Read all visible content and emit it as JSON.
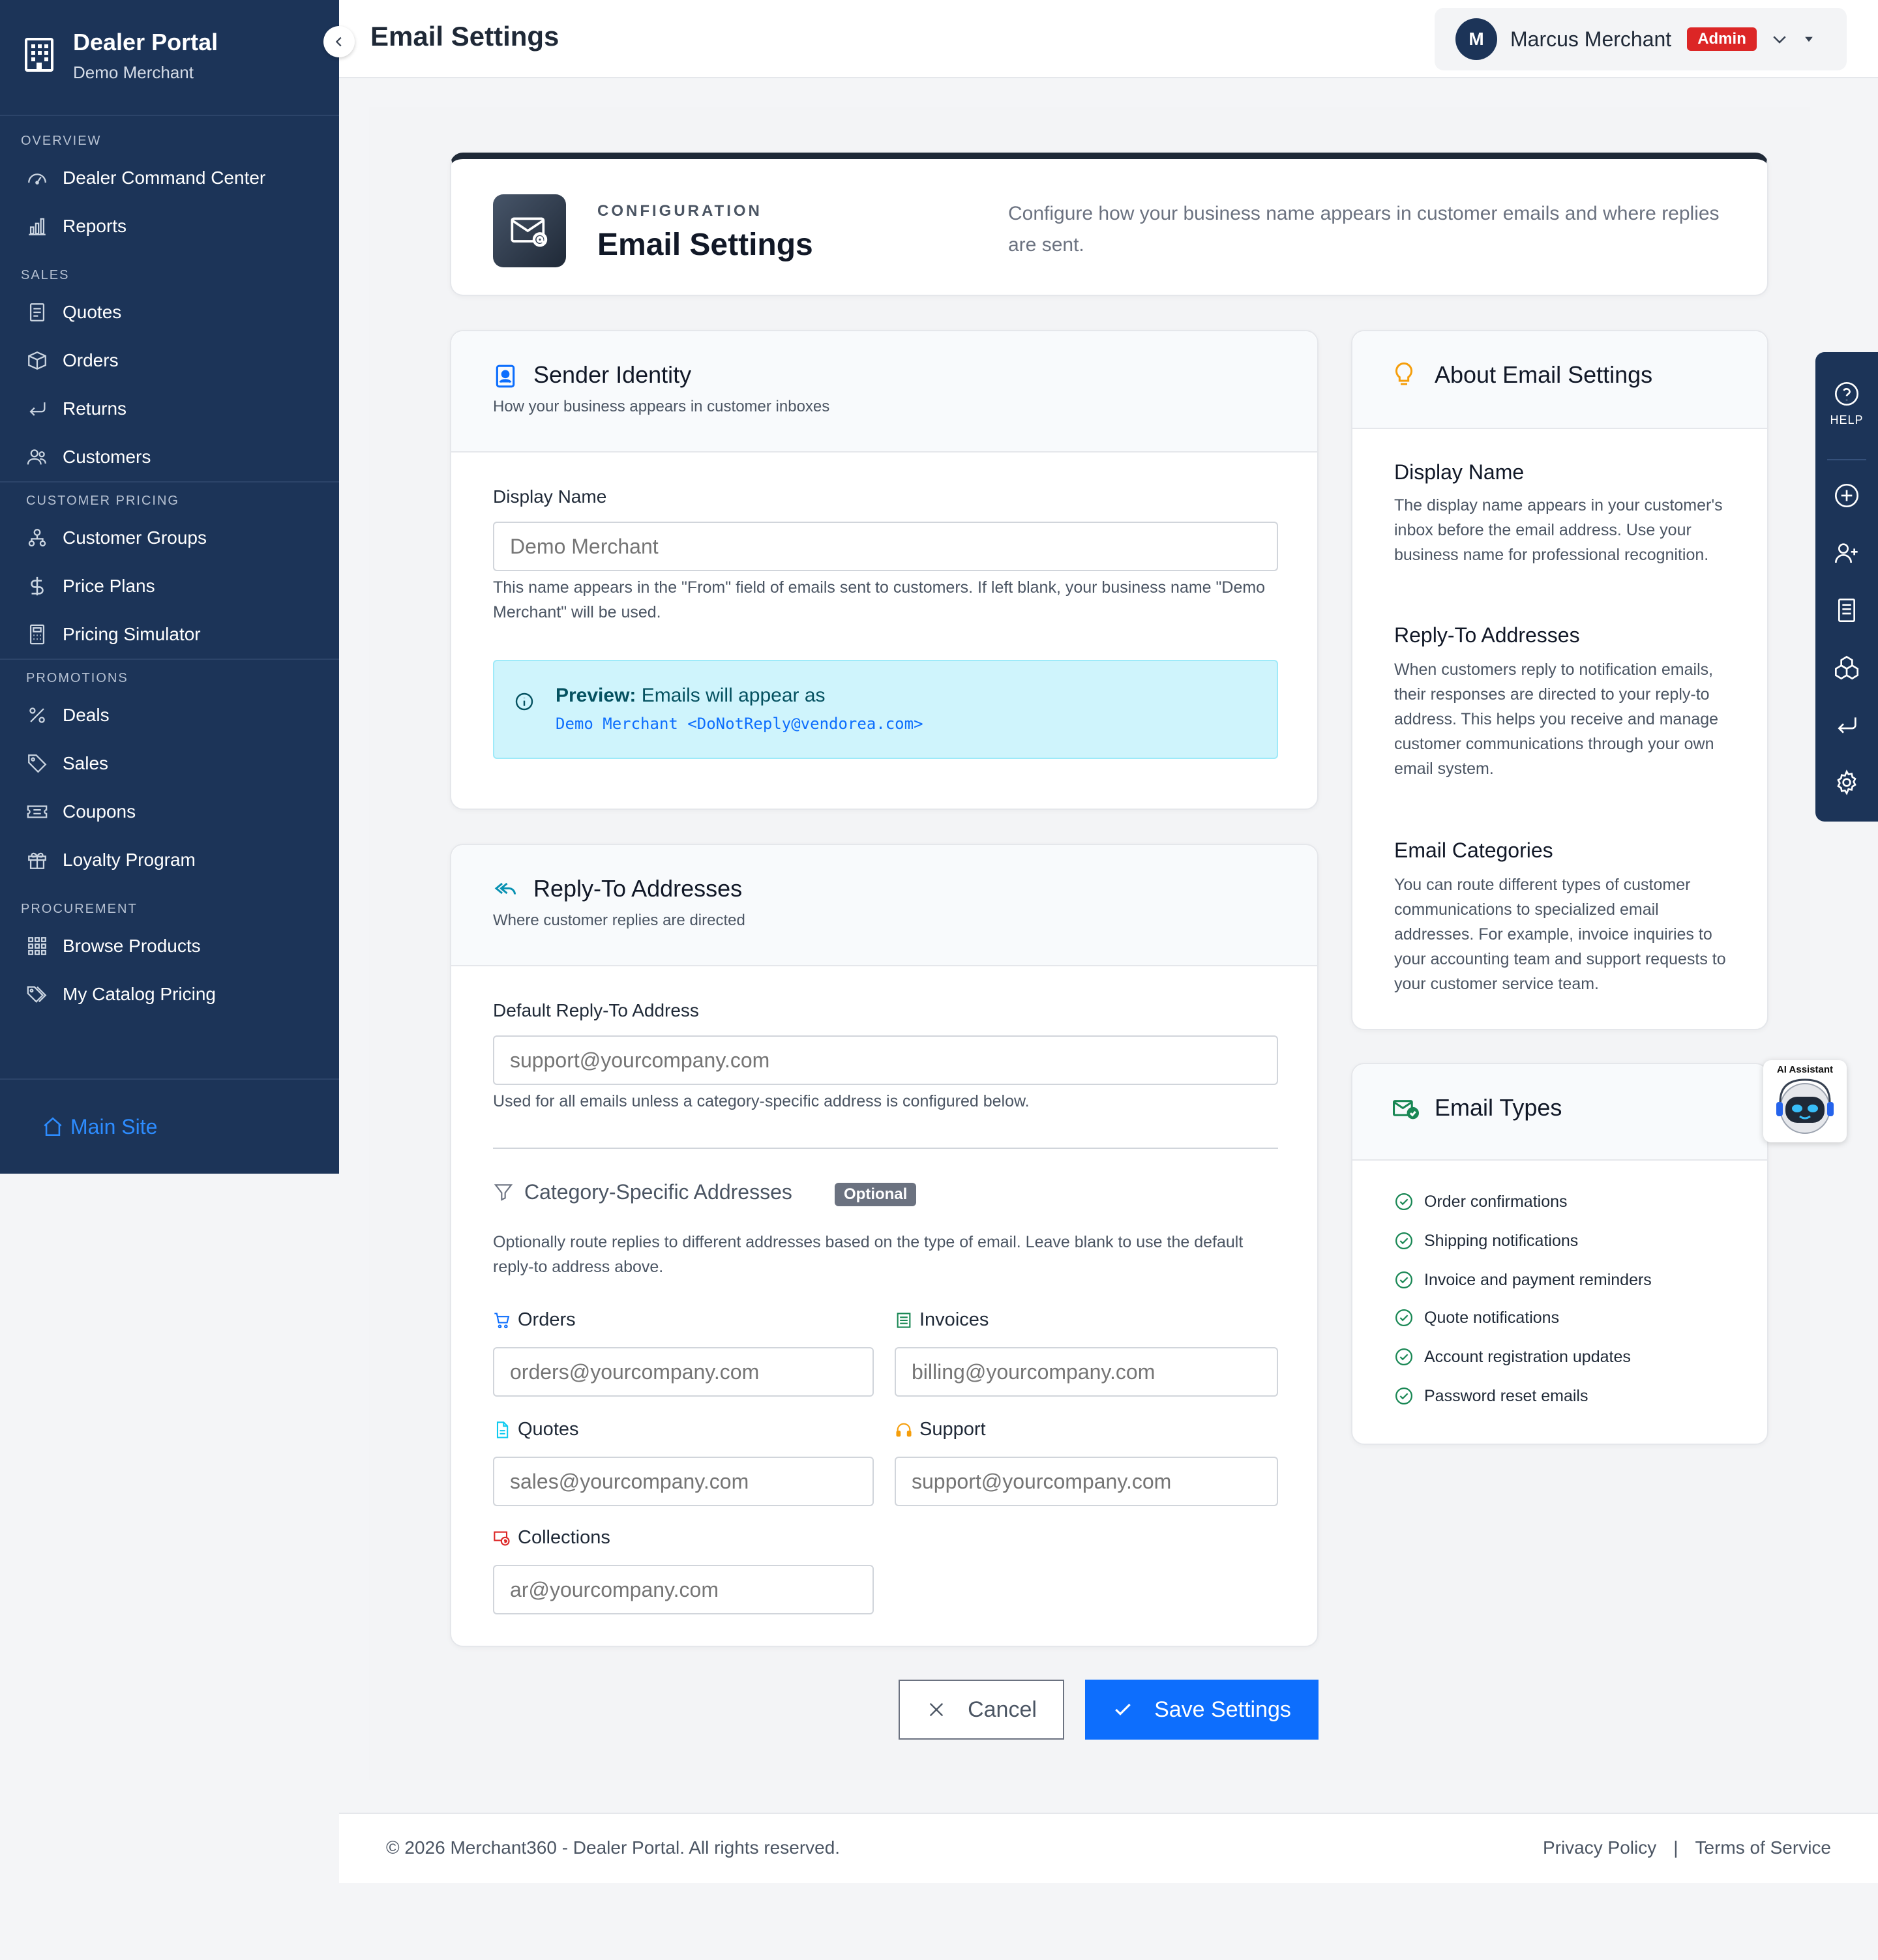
{
  "sidebar": {
    "title": "Dealer Portal",
    "subtitle": "Demo Merchant",
    "sections": [
      {
        "label": "OVERVIEW",
        "items": [
          {
            "label": "Dealer Command Center",
            "icon": "gauge-icon"
          },
          {
            "label": "Reports",
            "icon": "bar-chart-icon"
          }
        ]
      },
      {
        "label": "SALES",
        "items": [
          {
            "label": "Quotes",
            "icon": "document-icon"
          },
          {
            "label": "Orders",
            "icon": "box-icon"
          },
          {
            "label": "Returns",
            "icon": "return-arrow-icon"
          },
          {
            "label": "Customers",
            "icon": "people-icon"
          }
        ]
      },
      {
        "label": "CUSTOMER PRICING",
        "items": [
          {
            "label": "Customer Groups",
            "icon": "hierarchy-icon"
          },
          {
            "label": "Price Plans",
            "icon": "dollar-icon"
          },
          {
            "label": "Pricing Simulator",
            "icon": "calculator-icon"
          }
        ]
      },
      {
        "label": "PROMOTIONS",
        "items": [
          {
            "label": "Deals",
            "icon": "percent-icon"
          },
          {
            "label": "Sales",
            "icon": "tag-icon"
          },
          {
            "label": "Coupons",
            "icon": "ticket-icon"
          },
          {
            "label": "Loyalty Program",
            "icon": "gift-icon"
          }
        ]
      },
      {
        "label": "PROCUREMENT",
        "items": [
          {
            "label": "Browse Products",
            "icon": "grid-icon"
          },
          {
            "label": "My Catalog Pricing",
            "icon": "tags-icon"
          }
        ]
      }
    ],
    "main_site": "Main Site"
  },
  "topbar": {
    "title": "Email Settings",
    "user_initial": "M",
    "user_name": "Marcus Merchant",
    "role_badge": "Admin"
  },
  "hero": {
    "eyebrow": "CONFIGURATION",
    "title": "Email Settings",
    "description": "Configure how your business name appears in customer emails and where replies are sent."
  },
  "sender": {
    "title": "Sender Identity",
    "subtitle": "How your business appears in customer inboxes",
    "display_name_label": "Display Name",
    "display_name_placeholder": "Demo Merchant",
    "display_name_help": "This name appears in the \"From\" field of emails sent to customers. If left blank, your business name \"Demo Merchant\" will be used.",
    "preview_label": "Preview:",
    "preview_text": "Emails will appear as",
    "preview_address": "Demo Merchant <DoNotReply@vendorea.com>"
  },
  "reply": {
    "title": "Reply-To Addresses",
    "subtitle": "Where customer replies are directed",
    "default_label": "Default Reply-To Address",
    "default_placeholder": "support@yourcompany.com",
    "default_help": "Used for all emails unless a category-specific address is configured below.",
    "category_title": "Category-Specific Addresses",
    "optional_badge": "Optional",
    "category_help": "Optionally route replies to different addresses based on the type of email. Leave blank to use the default reply-to address above.",
    "orders_label": "Orders",
    "orders_placeholder": "orders@yourcompany.com",
    "invoices_label": "Invoices",
    "invoices_placeholder": "billing@yourcompany.com",
    "quotes_label": "Quotes",
    "quotes_placeholder": "sales@yourcompany.com",
    "support_label": "Support",
    "support_placeholder": "support@yourcompany.com",
    "collections_label": "Collections",
    "collections_placeholder": "ar@yourcompany.com"
  },
  "actions": {
    "cancel": "Cancel",
    "save": "Save Settings"
  },
  "about": {
    "title": "About Email Settings",
    "h1": "Display Name",
    "p1": "The display name appears in your customer's inbox before the email address. Use your business name for professional recognition.",
    "h2": "Reply-To Addresses",
    "p2": "When customers reply to notification emails, their responses are directed to your reply-to address. This helps you receive and manage customer communications through your own email system.",
    "h3": "Email Categories",
    "p3": "You can route different types of customer communications to specialized email addresses. For example, invoice inquiries to your accounting team and support requests to your customer service team."
  },
  "types": {
    "title": "Email Types",
    "items": [
      "Order confirmations",
      "Shipping notifications",
      "Invoice and payment reminders",
      "Quote notifications",
      "Account registration updates",
      "Password reset emails"
    ]
  },
  "dock": {
    "help_label": "HELP"
  },
  "ai_assistant": {
    "label": "AI Assistant"
  },
  "footer": {
    "copyright": "© 2026 Merchant360 - Dealer Portal. All rights reserved.",
    "privacy": "Privacy Policy",
    "separator": "|",
    "terms": "Terms of Service"
  },
  "colors": {
    "sidebar_bg": "#1c3458",
    "primary": "#0d6efd",
    "admin_badge": "#dc2626",
    "preview_bg": "#cff4fc",
    "success": "#198754"
  }
}
